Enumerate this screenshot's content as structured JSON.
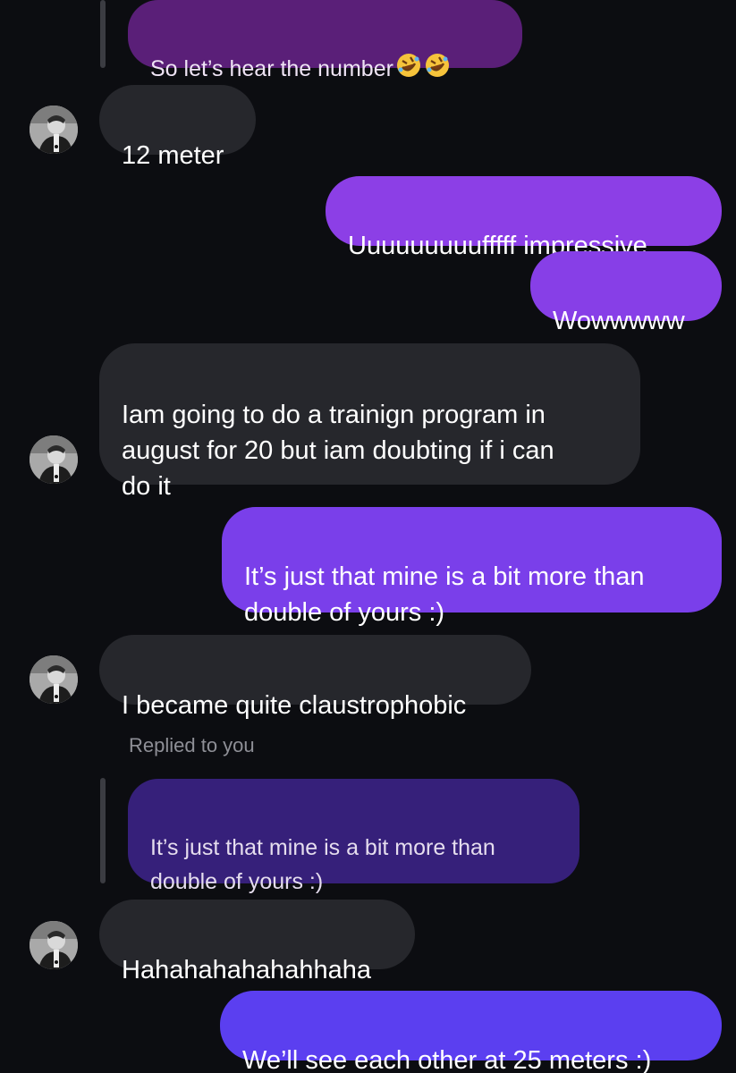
{
  "quoted_top": {
    "text": "So let’s hear the number",
    "emoji": [
      "rolling-on-floor-laughing-emoji",
      "rolling-on-floor-laughing-emoji"
    ]
  },
  "messages": [
    {
      "id": "m1",
      "side": "incoming",
      "text": "12 meter"
    },
    {
      "id": "m2",
      "side": "outgoing",
      "text": "Uuuuuuuuufffff impressive"
    },
    {
      "id": "m3",
      "side": "outgoing",
      "text": "Wowwwww"
    },
    {
      "id": "m4",
      "side": "incoming",
      "text": "Iam going to do a trainign program in\naugust for 20 but iam doubting if i can\ndo it"
    },
    {
      "id": "m5",
      "side": "outgoing",
      "text": "It’s just that mine is a bit more than\ndouble of yours :)"
    },
    {
      "id": "m6",
      "side": "incoming",
      "text": "I became quite claustrophobic"
    },
    {
      "id": "m7",
      "side": "incoming",
      "text": "Hahahahahahahhaha"
    },
    {
      "id": "m8",
      "side": "outgoing",
      "text": "We’ll see each other at 25 meters :)"
    }
  ],
  "reply": {
    "label": "Replied to you",
    "quoted_text": "It’s just that mine is a bit more than\ndouble of yours :)"
  },
  "colors": {
    "background": "#0c0d11",
    "incoming_bubble": "#26272c",
    "outgoing_gradient_top": "#8f3fe6",
    "outgoing_gradient_bottom": "#5d3ff0",
    "quoted_bubble": "#3a1f72"
  }
}
